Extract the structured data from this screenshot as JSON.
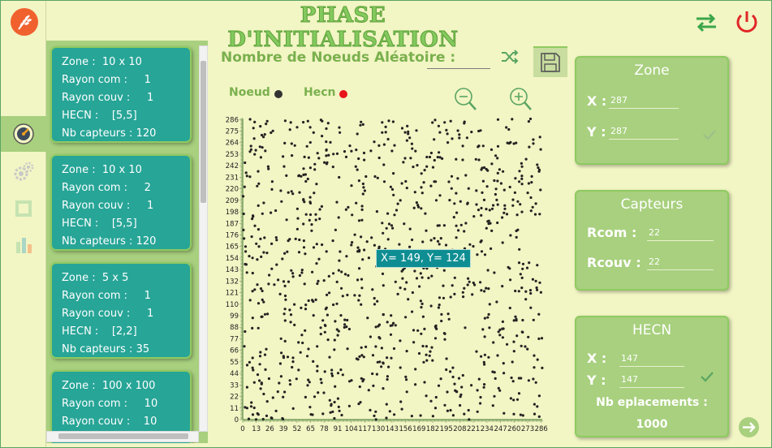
{
  "app": {
    "title": "PHASE D'INITIALISATION"
  },
  "icons": {
    "logo": "wheat-logo-icon",
    "swap": "swap-arrows-icon",
    "power": "power-icon",
    "sidebar": [
      "gauge-icon",
      "gears-icon",
      "square-icon",
      "bar-chart-icon"
    ],
    "shuffle": "shuffle-icon",
    "save": "floppy-disk-icon",
    "zoom_out": "zoom-out-icon",
    "zoom_in": "zoom-in-icon",
    "check": "check-icon",
    "next": "arrow-right-circle-icon"
  },
  "colors": {
    "background": "#f2f5c4",
    "panel_green": "#a8d07e",
    "card_teal": "#27a597",
    "title_green": "#83c95e",
    "node": "#222222",
    "hecn": "#e8141b",
    "tooltip": "#0e8e92"
  },
  "config_cards": [
    {
      "zone": "Zone :  10 x 10",
      "rcom": "Rayon com :     1",
      "rcouv": "Rayon couv :     1",
      "hecn": "HECN :    [5,5]",
      "nb": "Nb capteurs : 120"
    },
    {
      "zone": "Zone :  10 x 10",
      "rcom": "Rayon com :     2",
      "rcouv": "Rayon couv :     1",
      "hecn": "HECN :    [5,5]",
      "nb": "Nb capteurs : 120"
    },
    {
      "zone": "Zone :  5 x 5",
      "rcom": "Rayon com :     1",
      "rcouv": "Rayon couv :     1",
      "hecn": "HECN :    [2,2]",
      "nb": "Nb capteurs : 35"
    },
    {
      "zone": "Zone :  100 x 100",
      "rcom": "Rayon com :     10",
      "rcouv": "Rayon couv :    10",
      "hecn": "",
      "nb": ""
    }
  ],
  "random_nodes": {
    "label": "Nombre de Noeuds Aléatoire :",
    "value": ""
  },
  "legend": {
    "node": "Noeud",
    "hecn": "Hecn"
  },
  "tooltip": "X= 149, Y= 124",
  "zone_panel": {
    "title": "Zone",
    "x_label": "X :",
    "y_label": "Y :",
    "x": "287",
    "y": "287"
  },
  "sensors_panel": {
    "title": "Capteurs",
    "rcom_label": "Rcom :",
    "rcouv_label": "Rcouv :",
    "rcom": "22",
    "rcouv": "22"
  },
  "hecn_panel": {
    "title": "HECN",
    "x_label": "X :",
    "y_label": "Y :",
    "x": "147",
    "y": "147",
    "placements_label": "Nb eplacements :",
    "placements_value": "1000"
  },
  "chart_data": {
    "type": "scatter",
    "title": "",
    "xlabel": "",
    "ylabel": "",
    "xlim": [
      0,
      287
    ],
    "ylim": [
      0,
      287
    ],
    "x_ticks": [
      0,
      13,
      26,
      39,
      52,
      65,
      78,
      91,
      104,
      117,
      130,
      143,
      156,
      169,
      182,
      195,
      208,
      221,
      234,
      247,
      260,
      273,
      286
    ],
    "y_ticks": [
      0,
      11,
      22,
      33,
      44,
      55,
      66,
      77,
      88,
      99,
      110,
      121,
      132,
      143,
      154,
      165,
      176,
      187,
      198,
      209,
      220,
      231,
      242,
      253,
      264,
      275,
      286
    ],
    "series": [
      {
        "name": "Noeud",
        "point_count": 1000,
        "x_range": [
          0,
          287
        ],
        "y_range": [
          0,
          287
        ],
        "distribution": "uniform random"
      },
      {
        "name": "Hecn",
        "x": [],
        "y": []
      }
    ]
  }
}
